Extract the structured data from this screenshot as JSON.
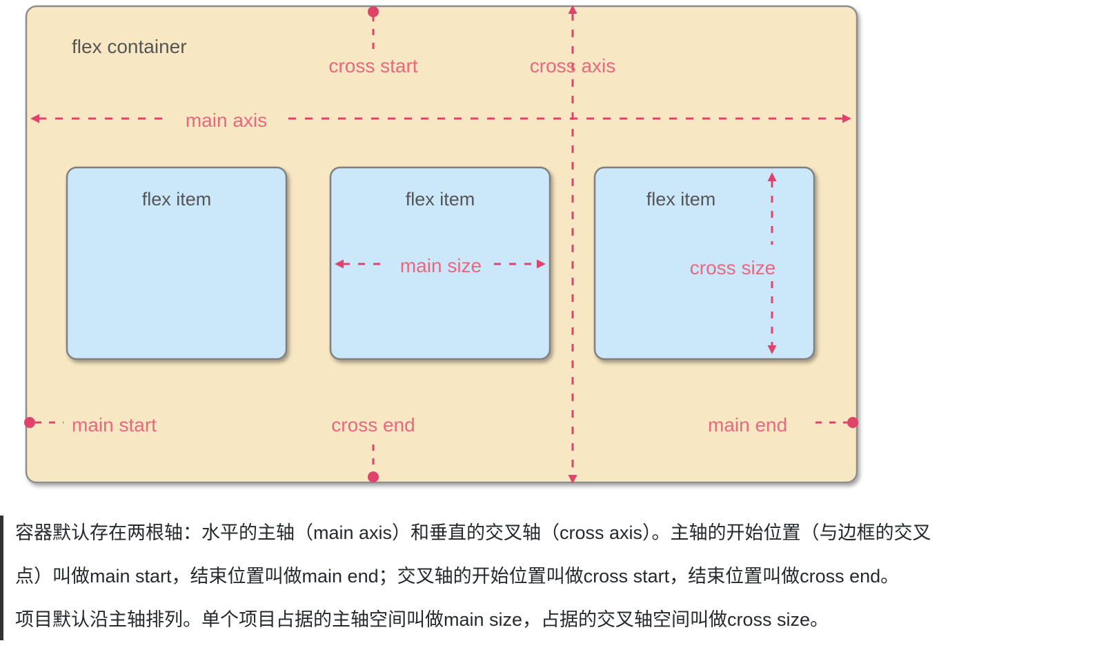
{
  "diagram": {
    "title": "flex box model diagram",
    "container_label": "flex container",
    "axes": {
      "main_axis": "main axis",
      "cross_axis": "cross axis",
      "cross_start": "cross start",
      "cross_end": "cross end",
      "main_start": "main start",
      "main_end": "main end"
    },
    "items": [
      {
        "label": "flex item",
        "annotation": ""
      },
      {
        "label": "flex item",
        "annotation": "main size"
      },
      {
        "label": "flex item",
        "annotation": "cross size"
      }
    ],
    "colors": {
      "container_fill": "#f7e7c3",
      "container_border": "#8d8d8d",
      "item_fill": "#cbe7fa",
      "item_border": "#7f7f7f",
      "accent": "#e0436a",
      "accent_label": "#e8697f",
      "text_gray": "#555555"
    }
  },
  "caption": {
    "lines": [
      "容器默认存在两根轴：水平的主轴（main axis）和垂直的交叉轴（cross axis）。主轴的开始位置（与边框的交叉",
      "点）叫做main start，结束位置叫做main end；交叉轴的开始位置叫做cross start，结束位置叫做cross end。",
      "项目默认沿主轴排列。单个项目占据的主轴空间叫做main size，占据的交叉轴空间叫做cross size。"
    ]
  }
}
